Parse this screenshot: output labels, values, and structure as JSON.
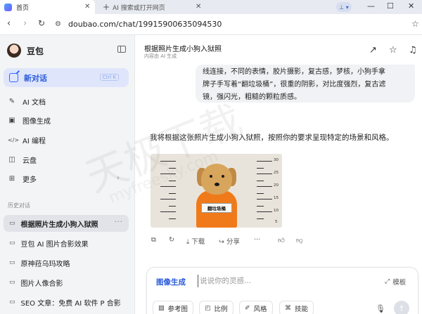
{
  "browser": {
    "active_tab_title": "首页",
    "new_tab_title": "AI 搜索或打开网页",
    "url": "doubao.com/chat/19915900635094530",
    "profile_badge": "⊥ ▾"
  },
  "sidebar": {
    "brand": "豆包",
    "new_chat_label": "新对话",
    "new_chat_shortcut": "Ctrl K",
    "menu": [
      {
        "icon": "pen-icon",
        "glyph": "✎",
        "label": "AI 文档"
      },
      {
        "icon": "image-icon",
        "glyph": "▣",
        "label": "图像生成"
      },
      {
        "icon": "code-icon",
        "glyph": "</>",
        "label": "AI 编程"
      },
      {
        "icon": "cloud-disk-icon",
        "glyph": "◫",
        "label": "云盘"
      },
      {
        "icon": "grid-icon",
        "glyph": "⊞",
        "label": "更多"
      }
    ],
    "history_label": "历史对话",
    "history": [
      {
        "label": "根据照片生成小狗入狱照",
        "active": true
      },
      {
        "label": "豆包 AI 图片合影效果",
        "active": false
      },
      {
        "label": "原神菈乌玛攻略",
        "active": false
      },
      {
        "label": "图片人像合影",
        "active": false
      },
      {
        "label": "SEO 文章：免费 AI 软件 P 合影",
        "active": false
      }
    ]
  },
  "chat": {
    "title": "根据照片生成小狗入狱照",
    "subtitle": "内容由 AI 生成",
    "user_message_lines": [
      "线连接，不同的表情，胶片摄影，复古感，梦核，小狗手拿",
      "牌子手写着“翻垃圾桶”，很重的阴影，对比度强烈，复古滤",
      "镜，强闪光，粗糙的颗粒质感。"
    ],
    "assistant_text": "我将根据这张照片生成小狗入狱照，按照你的要求呈现特定的场景和风格。",
    "image_sign_text": "翻垃圾桶",
    "ruler_numbers": [
      "30",
      "25",
      "20",
      "15",
      "10",
      "5"
    ],
    "actions": {
      "download": "下载",
      "share": "分享"
    }
  },
  "input": {
    "mode": "图像生成",
    "placeholder": "说说你的灵感...",
    "template": "模板",
    "chips": [
      {
        "icon": "reference-image-icon",
        "glyph": "▧",
        "label": "参考图"
      },
      {
        "icon": "ratio-icon",
        "glyph": "◰",
        "label": "比例"
      },
      {
        "icon": "style-brush-icon",
        "glyph": "✐",
        "label": "风格"
      },
      {
        "icon": "skill-icon",
        "glyph": "⌘",
        "label": "技能"
      }
    ]
  },
  "colors": {
    "accent": "#3366ff",
    "sidebar_bg": "#f3f4f6",
    "prison_jumpsuit": "#f07a1a"
  }
}
